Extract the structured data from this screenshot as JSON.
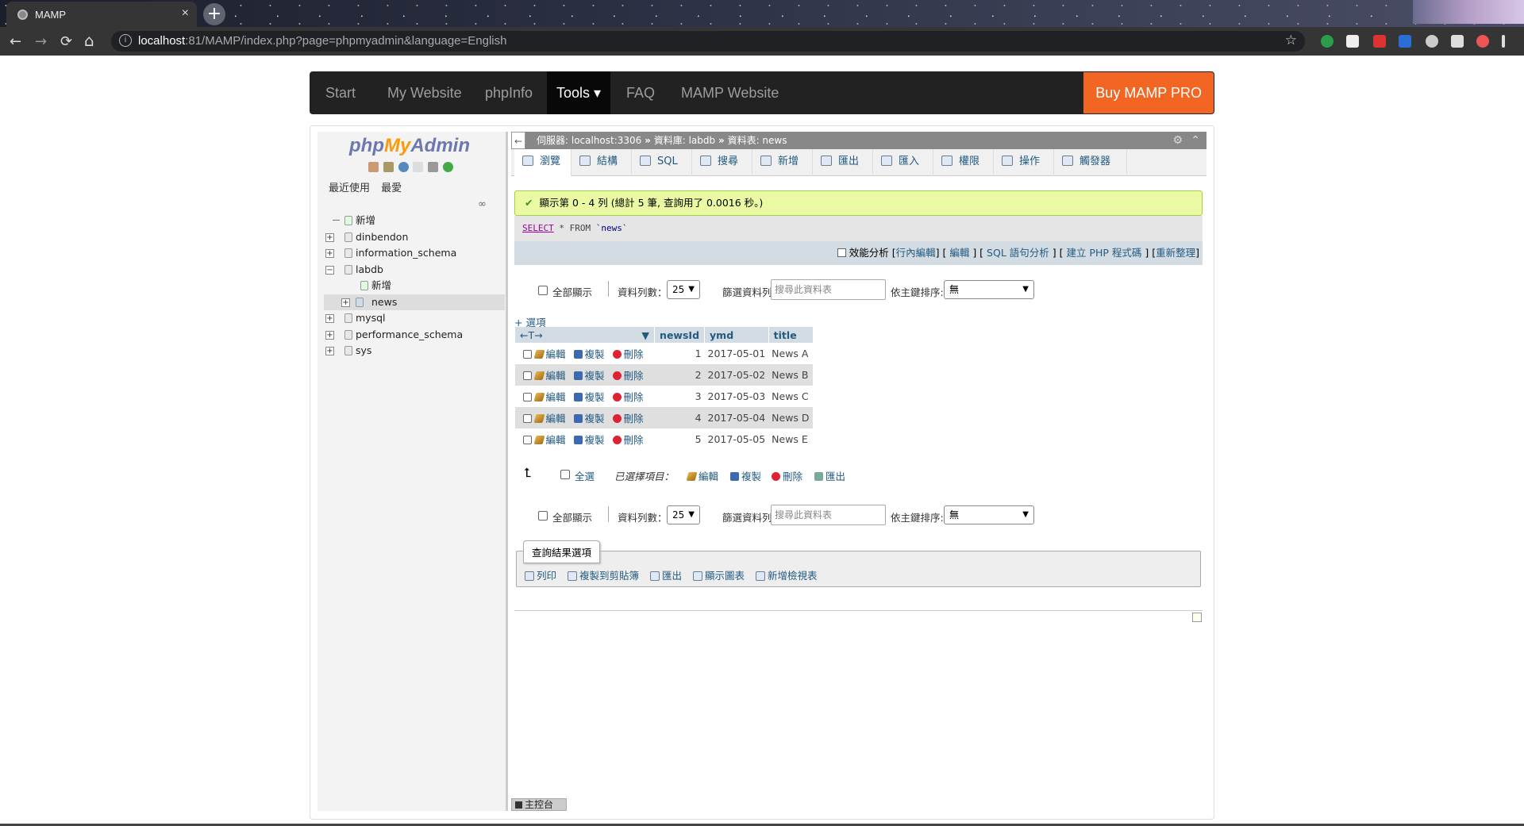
{
  "browser": {
    "tab_title": "MAMP",
    "tab_close": "×",
    "new_tab": "+",
    "url_host": "localhost",
    "url_rest": ":81/MAMP/index.php?page=phpmyadmin&language=English",
    "back": "←",
    "forward": "→",
    "reload": "⟳",
    "home": "⌂",
    "star": "☆"
  },
  "mamp_nav": {
    "items": [
      "Start",
      "My Website",
      "phpInfo",
      "Tools ▾",
      "FAQ",
      "MAMP Website"
    ],
    "buy": "Buy MAMP PRO"
  },
  "pma_nav": {
    "logo_php": "php",
    "logo_my": "My",
    "logo_admin": "Admin",
    "recent": "最近使用",
    "favorites": "最愛",
    "link_icon": "∞",
    "tree": [
      {
        "label": "新增",
        "level": 0,
        "icon": "new"
      },
      {
        "label": "dinbendon",
        "level": 0,
        "icon": "db"
      },
      {
        "label": "information_schema",
        "level": 0,
        "icon": "db"
      },
      {
        "label": "labdb",
        "level": 0,
        "icon": "db",
        "expanded": true
      },
      {
        "label": "新增",
        "level": 1,
        "icon": "new"
      },
      {
        "label": "news",
        "level": 1,
        "icon": "table",
        "selected": true
      },
      {
        "label": "mysql",
        "level": 0,
        "icon": "db"
      },
      {
        "label": "performance_schema",
        "level": 0,
        "icon": "db"
      },
      {
        "label": "sys",
        "level": 0,
        "icon": "db"
      }
    ]
  },
  "breadcrumb": {
    "back": "←",
    "server": "伺服器: localhost:3306",
    "db": "資料庫: labdb",
    "table": "資料表: news",
    "sep": "»"
  },
  "tabs": [
    "瀏覽",
    "結構",
    "SQL",
    "搜尋",
    "新增",
    "匯出",
    "匯入",
    "權限",
    "操作",
    "觸發器"
  ],
  "result": {
    "message": "顯示第 0 - 4 列 (總計 5 筆, 查詢用了 0.0016 秒。)",
    "check": "✔",
    "sql_select": "SELECT",
    "sql_rest": " * FROM ",
    "sql_table": "`news`",
    "profiling": "效能分析",
    "links": [
      "行內編輯",
      "編輯",
      "SQL 語句分析",
      "建立 PHP 程式碼",
      "重新整理"
    ]
  },
  "nav_controls": {
    "show_all": "全部顯示",
    "rows_label": "資料列數：",
    "rows_value": "25",
    "filter_label": "篩選資料列:",
    "filter_placeholder": "搜尋此資料表",
    "sort_label": "依主鍵排序:",
    "sort_value": "無"
  },
  "options_link": "+ 選項",
  "grid": {
    "arrows": "←T→",
    "columns": [
      "newsId",
      "ymd",
      "title"
    ],
    "actions": {
      "edit": "編輯",
      "copy": "複製",
      "delete": "刪除"
    },
    "rows": [
      {
        "newsId": "1",
        "ymd": "2017-05-01",
        "title": "News A"
      },
      {
        "newsId": "2",
        "ymd": "2017-05-02",
        "title": "News B"
      },
      {
        "newsId": "3",
        "ymd": "2017-05-03",
        "title": "News C"
      },
      {
        "newsId": "4",
        "ymd": "2017-05-04",
        "title": "News D"
      },
      {
        "newsId": "5",
        "ymd": "2017-05-05",
        "title": "News E"
      }
    ]
  },
  "bulk": {
    "select_all": "全選",
    "with_selected": "已選擇項目：",
    "edit": "編輯",
    "copy": "複製",
    "delete": "刪除",
    "export": "匯出"
  },
  "qro": {
    "legend": "查詢結果選項",
    "print": "列印",
    "copy_clipboard": "複製到剪貼簿",
    "export": "匯出",
    "chart": "顯示圖表",
    "create_view": "新增檢視表"
  },
  "console": "主控台"
}
